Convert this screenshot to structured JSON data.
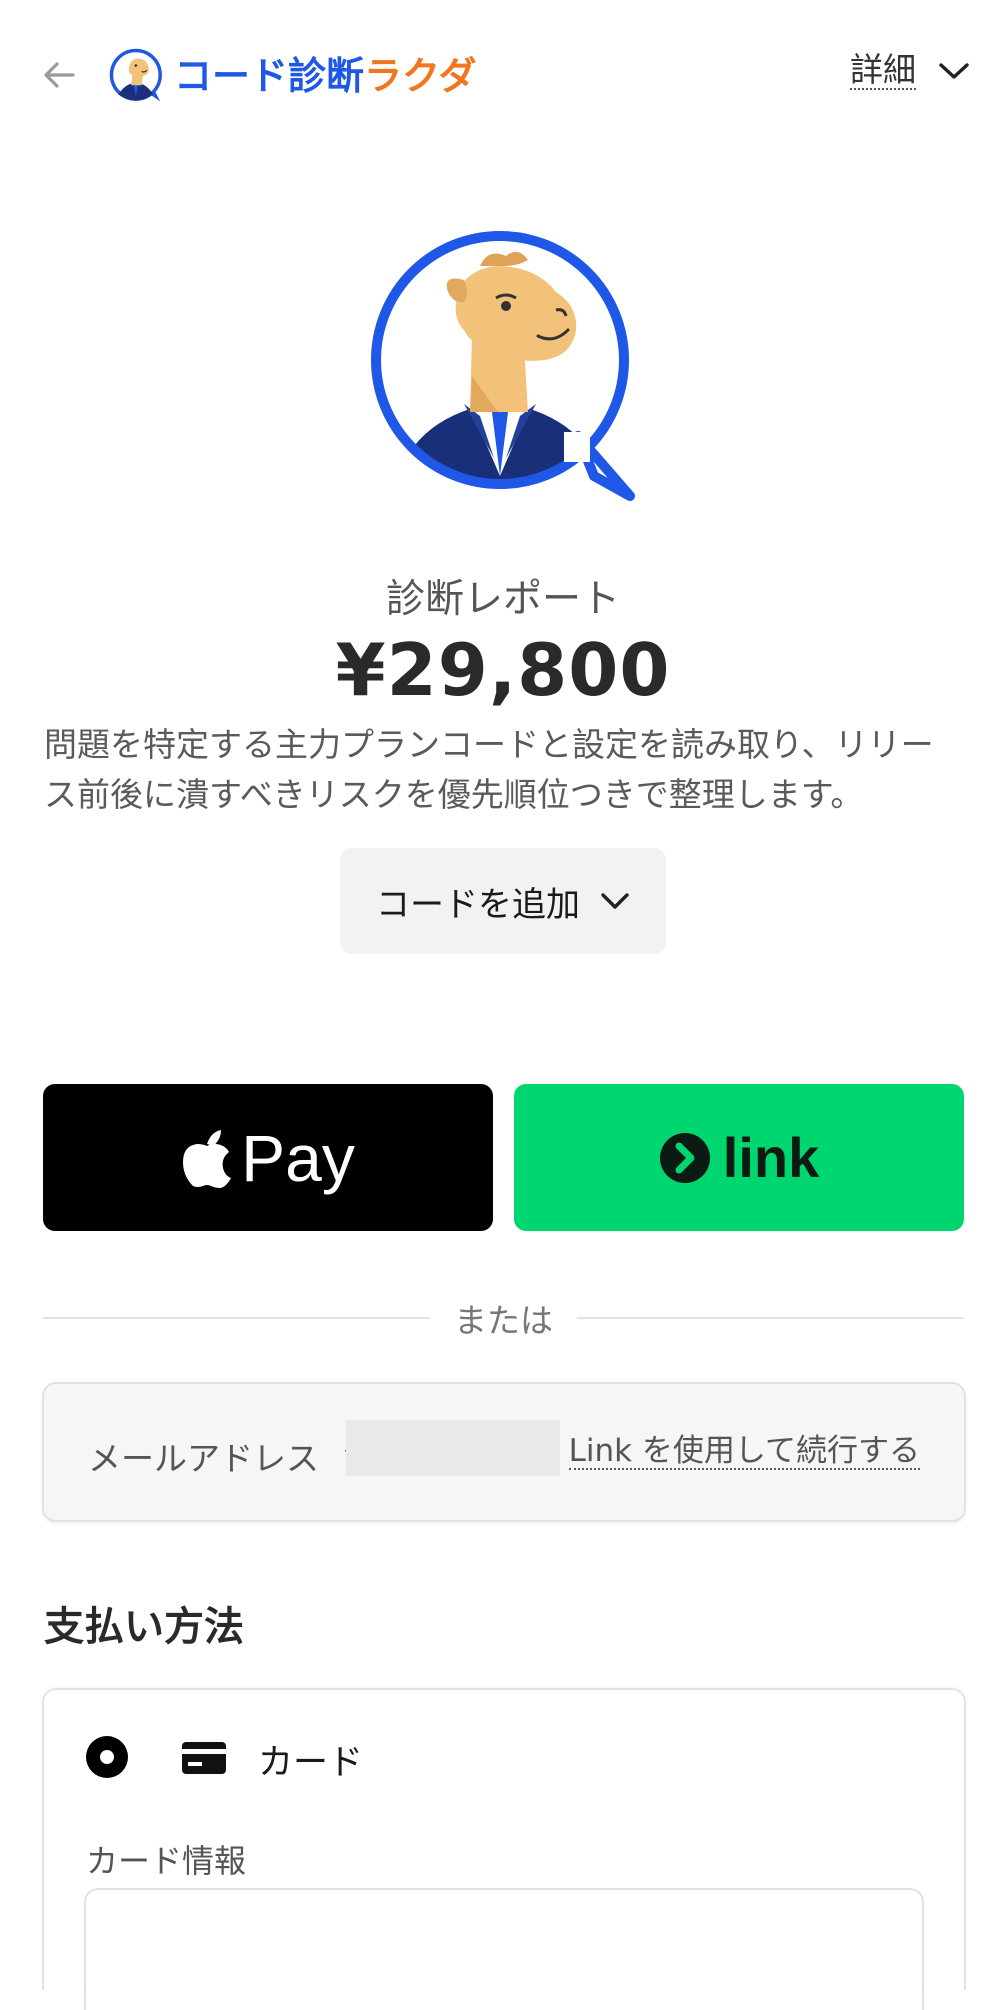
{
  "header": {
    "brand_part1": "コード診断",
    "brand_part2": "ラクダ",
    "details_label": "詳細"
  },
  "product": {
    "name": "診断レポート",
    "price": "¥29,800",
    "description": "問題を特定する主力プランコードと設定を読み取り、リリース前後に潰すべきリスクを優先順位つきで整理します。",
    "add_code_label": "コードを追加"
  },
  "wallet": {
    "apple_pay_label": "Pay",
    "link_label": "link"
  },
  "divider": {
    "or_text": "または"
  },
  "email": {
    "label": "メールアドレス",
    "partial_char": "ゝ",
    "link_continue": "Link を使用して続行する"
  },
  "payment": {
    "heading": "支払い方法",
    "card_option_label": "カード",
    "card_info_label": "カード情報"
  },
  "colors": {
    "brand_blue": "#1f57e6",
    "brand_orange": "#f2751f",
    "link_green": "#00d66f",
    "apple_black": "#000000"
  },
  "icons": {
    "back": "arrow-left-icon",
    "details": "chevron-down-icon",
    "add_code": "chevron-down-icon",
    "apple": "apple-logo-icon",
    "link": "link-logo-icon",
    "card": "credit-card-icon"
  }
}
